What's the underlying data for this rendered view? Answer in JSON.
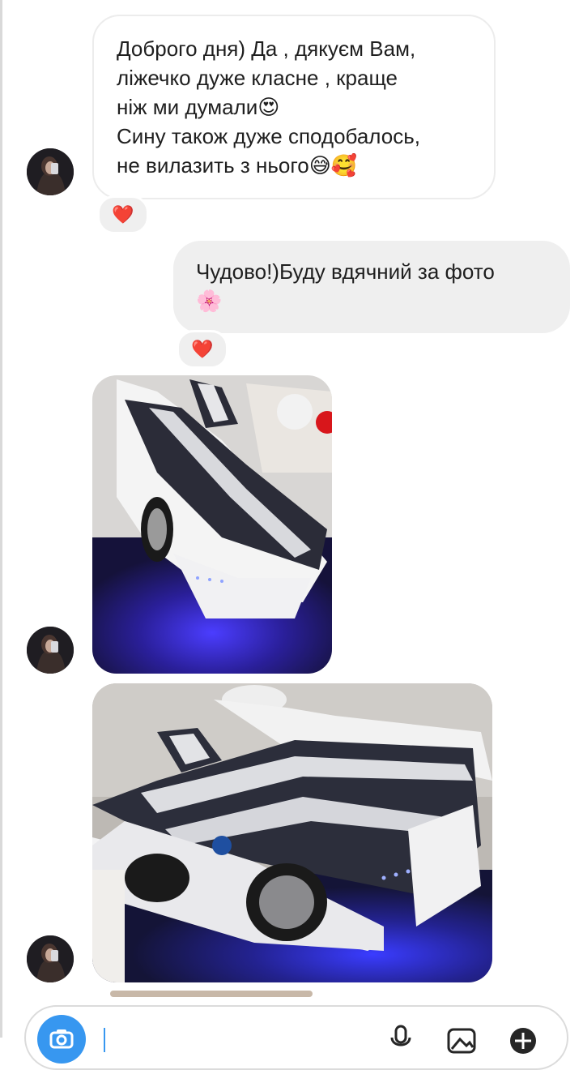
{
  "messages": [
    {
      "sender": "incoming",
      "text": "Доброго дня) Да , дякуєм Вам,\nліжечко дуже класне , краще\nніж ми думали😍\nСину також дуже сподобалось,\nне вилазить з нього😅🥰",
      "reaction": "❤️"
    },
    {
      "sender": "outgoing",
      "text": "Чудово!)Буду вдячний за фото\n🌸",
      "reaction": "❤️"
    },
    {
      "sender": "incoming",
      "type": "photo",
      "subject": "white car-shaped bed with blue underglow"
    },
    {
      "sender": "incoming",
      "type": "photo",
      "subject": "white car-shaped bed with blue underglow"
    }
  ],
  "composer": {
    "placeholder": ""
  },
  "colors": {
    "accent": "#3797f0",
    "bubble_outgoing": "#efefef",
    "heart": "#e0102a"
  },
  "icons": [
    "camera-icon",
    "microphone-icon",
    "gallery-icon",
    "sticker-icon",
    "heart-icon"
  ]
}
